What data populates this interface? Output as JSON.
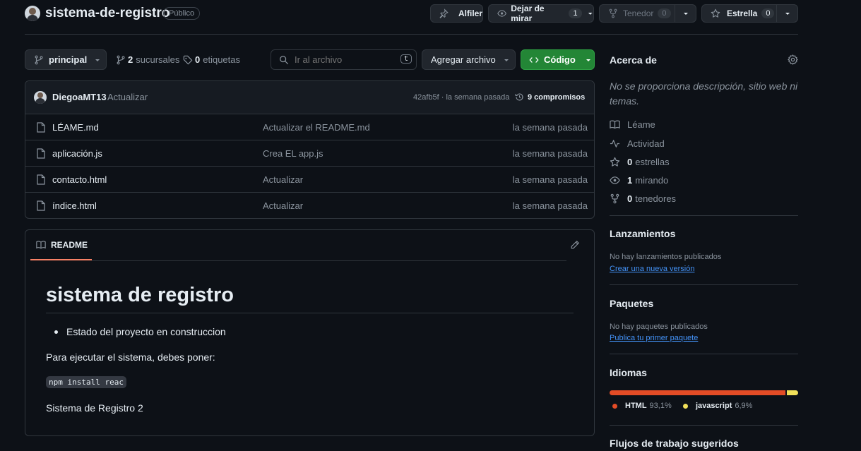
{
  "repo": {
    "name": "sistema-de-registro",
    "visibility": "Público"
  },
  "actions": {
    "pin_label": "Alfiler",
    "watch_label": "Dejar de mirar",
    "watch_count": "1",
    "fork_label": "Tenedor",
    "fork_count": "0",
    "star_label": "Estrella",
    "star_count": "0"
  },
  "toolbar": {
    "branch": "principal",
    "branches_count": "2",
    "branches_label": "sucursales",
    "tags_count": "0",
    "tags_label": "etiquetas",
    "search_placeholder": "Ir al archivo",
    "search_shortcut": "t",
    "add_file_label": "Agregar archivo",
    "code_label": "Código"
  },
  "commit": {
    "author": "DiegoaMT13",
    "message": "Actualizar",
    "hash_time": "42afb5f · la semana pasada",
    "commits_count": "9",
    "commits_label": "compromisos"
  },
  "files": [
    {
      "name": "LÉAME.md",
      "message": "Actualizar el README.md",
      "date": "la semana pasada"
    },
    {
      "name": "aplicación.js",
      "message": "Crea EL app.js",
      "date": "la semana pasada"
    },
    {
      "name": "contacto.html",
      "message": "Actualizar",
      "date": "la semana pasada"
    },
    {
      "name": "índice.html",
      "message": "Actualizar",
      "date": "la semana pasada"
    }
  ],
  "readme": {
    "tab_label": "README",
    "heading": "sistema de registro",
    "bullet": "Estado del proyecto en construccion",
    "paragraph": "Para ejecutar el sistema, debes poner:",
    "code": "npm install reac",
    "footer_text": "Sistema de Registro 2"
  },
  "sidebar": {
    "about_title": "Acerca de",
    "about_desc": "No se proporciona descripción, sitio web ni temas.",
    "readme_label": "Léame",
    "activity_label": "Actividad",
    "stars_count": "0",
    "stars_label": "estrellas",
    "watching_count": "1",
    "watching_label": "mirando",
    "forks_count": "0",
    "forks_label": "tenedores",
    "releases_title": "Lanzamientos",
    "releases_empty": "No hay lanzamientos publicados",
    "releases_link": "Crear una nueva versión",
    "packages_title": "Paquetes",
    "packages_empty": "No hay paquetes publicados",
    "packages_link": "Publica tu primer paquete",
    "languages_title": "Idiomas",
    "languages": [
      {
        "name": "HTML",
        "percent": "93,1%",
        "value": 93.1,
        "color": "#e34c26"
      },
      {
        "name": "javascript",
        "percent": "6,9%",
        "value": 6.9,
        "color": "#f1e05a"
      }
    ],
    "workflows_title": "Flujos de trabajo sugeridos"
  },
  "colors": {
    "accent_green": "#238636",
    "link_blue": "#4493f8",
    "readme_tab_underline": "#f78166"
  }
}
